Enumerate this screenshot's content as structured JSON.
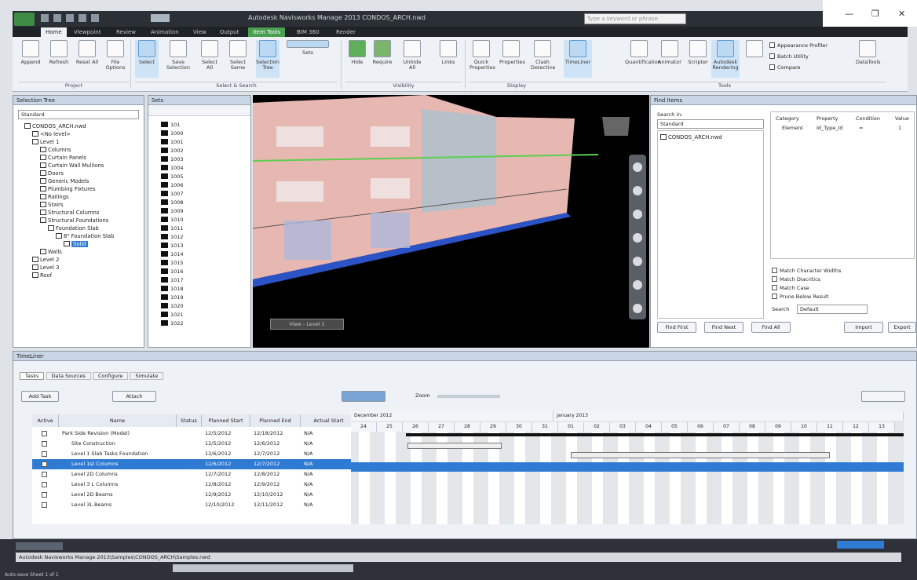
{
  "titlebar": {
    "title": "Autodesk Navisworks Manage 2013   CONDOS_ARCH.nwd",
    "search_placeholder": "Type a keyword or phrase"
  },
  "tabs": [
    "Home",
    "Viewpoint",
    "Review",
    "Animation",
    "View",
    "Output",
    "Item Tools",
    "BIM 360",
    "Render"
  ],
  "ribbon": {
    "buttons": [
      "Append",
      "Refresh",
      "Reset All",
      "File Options",
      "Select",
      "Save Selection",
      "Select All",
      "Select Same",
      "Selection Tree",
      "Sets",
      "Hide",
      "Require",
      "Unhide All",
      "Links",
      "Quick Properties",
      "Properties",
      "Clash Detective",
      "TimeLiner",
      "Quantification",
      "Animator",
      "Scripter",
      "Autodesk Rendering",
      "Appearance Profiler",
      "Batch Utility",
      "Compare",
      "DataTools"
    ],
    "groups": [
      "Project",
      "Select & Search",
      "Visibility",
      "Display",
      "Tools"
    ]
  },
  "selection_tree": {
    "title": "Selection Tree",
    "mode": "Standard",
    "items": [
      "CONDOS_ARCH.nwd",
      "<No level>",
      "Level 1",
      "Columns",
      "Curtain Panels",
      "Curtain Wall Mullions",
      "Doors",
      "Generic Models",
      "Plumbing Fixtures",
      "Railings",
      "Stairs",
      "Structural Columns",
      "Structural Foundations",
      "Foundation Slab",
      "8\" Foundation Slab",
      "Solid",
      "Walls",
      "Level 2",
      "Level 3",
      "Roof"
    ]
  },
  "sets_panel": {
    "title": "Sets",
    "items": [
      "101",
      "1000",
      "1001",
      "1002",
      "1003",
      "1004",
      "1005",
      "1006",
      "1007",
      "1008",
      "1009",
      "1010",
      "1011",
      "1012",
      "1013",
      "1014",
      "1015",
      "1016",
      "1017",
      "1018",
      "1019",
      "1020",
      "1021",
      "1022"
    ]
  },
  "viewport": {
    "label": "View - Level 1"
  },
  "find_items": {
    "title": "Find Items",
    "search_in": "Standard",
    "tree_item": "CONDOS_ARCH.nwd",
    "columns": [
      "Category",
      "Property",
      "Condition",
      "Value"
    ],
    "row": [
      "Element",
      "Id_Type_Id",
      "=",
      "1"
    ],
    "checks": [
      "Match Character Widths",
      "Match Diacritics",
      "Match Case",
      "Prune Below Result"
    ],
    "search_label": "Search",
    "search_value": "Default",
    "buttons": [
      "Find First",
      "Find Next",
      "Find All",
      "Import",
      "Export"
    ]
  },
  "timeliner": {
    "title": "TimeLiner",
    "tabs": [
      "Tasks",
      "Data Sources",
      "Configure",
      "Simulate"
    ],
    "add_task": "Add Task",
    "attach": "Attach",
    "zoom_label": "Zoom",
    "headers": [
      "Active",
      "Name",
      "Status",
      "Planned Start",
      "Planned End",
      "Actual Start"
    ],
    "rows": [
      {
        "name": "Park Side Revision (Model)",
        "status": "",
        "ps": "12/5/2012",
        "pe": "12/18/2012",
        "as": "N/A"
      },
      {
        "name": "Site Construction",
        "status": "",
        "ps": "12/5/2012",
        "pe": "12/6/2012",
        "as": "N/A"
      },
      {
        "name": "Level 1 Slab Tasks Foundation",
        "status": "",
        "ps": "12/6/2012",
        "pe": "12/7/2012",
        "as": "N/A"
      },
      {
        "name": "Level 1st Columns",
        "status": "",
        "ps": "12/6/2012",
        "pe": "12/7/2012",
        "as": "N/A"
      },
      {
        "name": "Level 2D Columns",
        "status": "",
        "ps": "12/7/2012",
        "pe": "12/8/2012",
        "as": "N/A"
      },
      {
        "name": "Level 3 L Columns",
        "status": "",
        "ps": "12/8/2012",
        "pe": "12/9/2012",
        "as": "N/A"
      },
      {
        "name": "Level 2D Beams",
        "status": "",
        "ps": "12/9/2012",
        "pe": "12/10/2012",
        "as": "N/A"
      },
      {
        "name": "Level 3L Beams",
        "status": "",
        "ps": "12/10/2012",
        "pe": "12/11/2012",
        "as": "N/A"
      }
    ],
    "months": [
      "December 2012",
      "January 2013"
    ],
    "days": [
      "24",
      "25",
      "26",
      "27",
      "28",
      "29",
      "30",
      "31",
      "01",
      "02",
      "03",
      "04",
      "05",
      "06",
      "07",
      "08",
      "09",
      "10",
      "11",
      "12",
      "13"
    ]
  },
  "statusbar": {
    "path": "Autodesk Navisworks Manage 2013\\Samples\\CONDOS_ARCH\\Samples.nwd",
    "note": "Auto-save   Sheet 1 of 1"
  }
}
